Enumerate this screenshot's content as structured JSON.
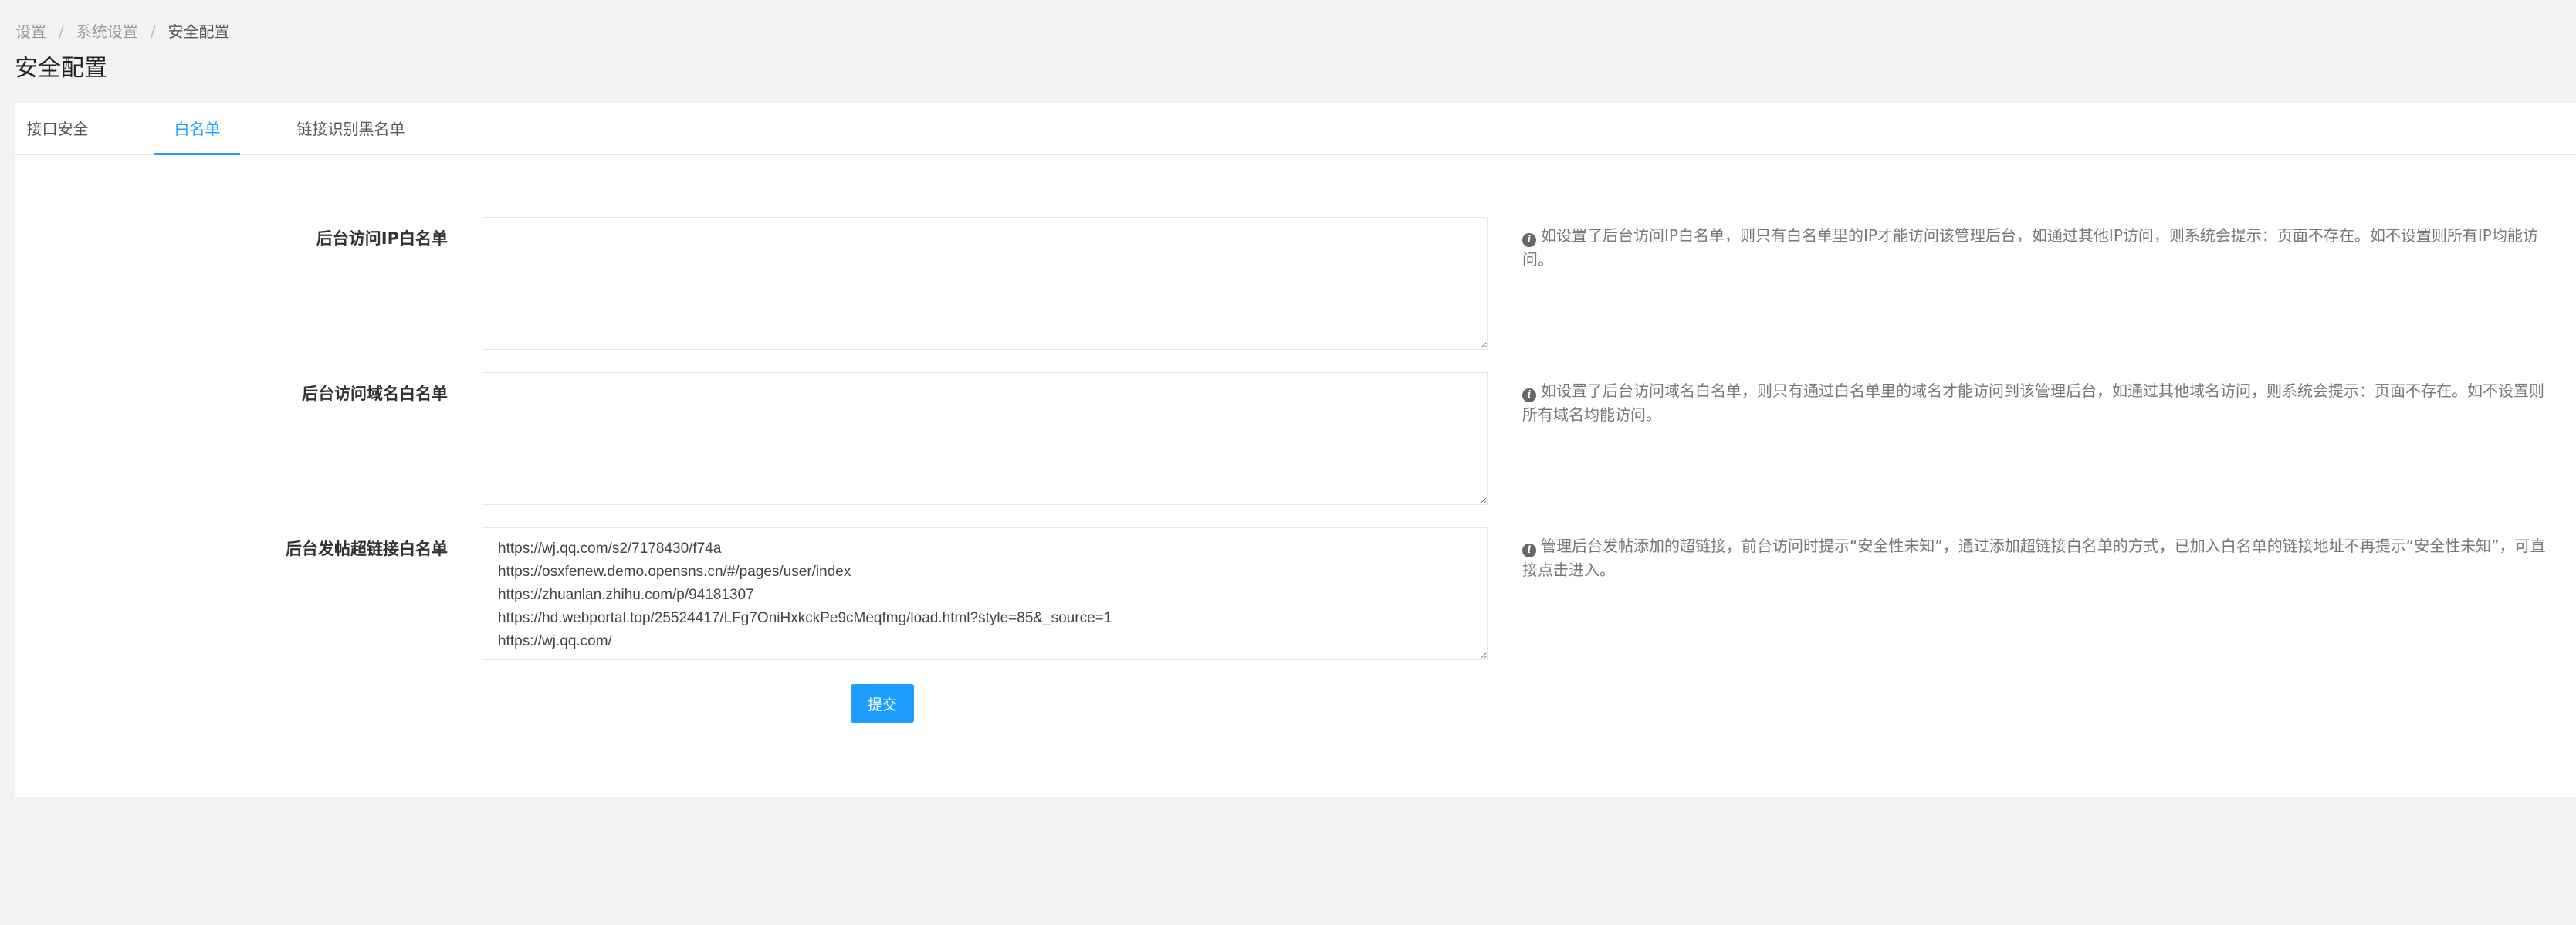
{
  "breadcrumb": {
    "items": [
      "设置",
      "系统设置",
      "安全配置"
    ],
    "separator": "/"
  },
  "page_title": "安全配置",
  "tabs": [
    {
      "label": "接口安全",
      "active": false
    },
    {
      "label": "白名单",
      "active": true
    },
    {
      "label": "链接识别黑名单",
      "active": false
    }
  ],
  "form": {
    "rows": [
      {
        "label": "后台访问IP白名单",
        "value": "",
        "help": "如设置了后台访问IP白名单，则只有白名单里的IP才能访问该管理后台，如通过其他IP访问，则系统会提示：页面不存在。如不设置则所有IP均能访问。"
      },
      {
        "label": "后台访问域名白名单",
        "value": "",
        "help": "如设置了后台访问域名白名单，则只有通过白名单里的域名才能访问到该管理后台，如通过其他域名访问，则系统会提示：页面不存在。如不设置则所有域名均能访问。"
      },
      {
        "label": "后台发帖超链接白名单",
        "value": "https://wj.qq.com/s2/7178430/f74a\nhttps://osxfenew.demo.opensns.cn/#/pages/user/index\nhttps://zhuanlan.zhihu.com/p/94181307\nhttps://hd.webportal.top/25524417/LFg7OniHxkckPe9cMeqfmg/load.html?style=85&_source=1\nhttps://wj.qq.com/",
        "help": "管理后台发帖添加的超链接，前台访问时提示“安全性未知”，通过添加超链接白名单的方式，已加入白名单的链接地址不再提示“安全性未知”，可直接点击进入。"
      }
    ],
    "submit_label": "提交"
  },
  "colors": {
    "accent": "#1e9fff",
    "page_background": "#f3f3f3"
  },
  "icons": {
    "help": "info-circle-icon"
  }
}
